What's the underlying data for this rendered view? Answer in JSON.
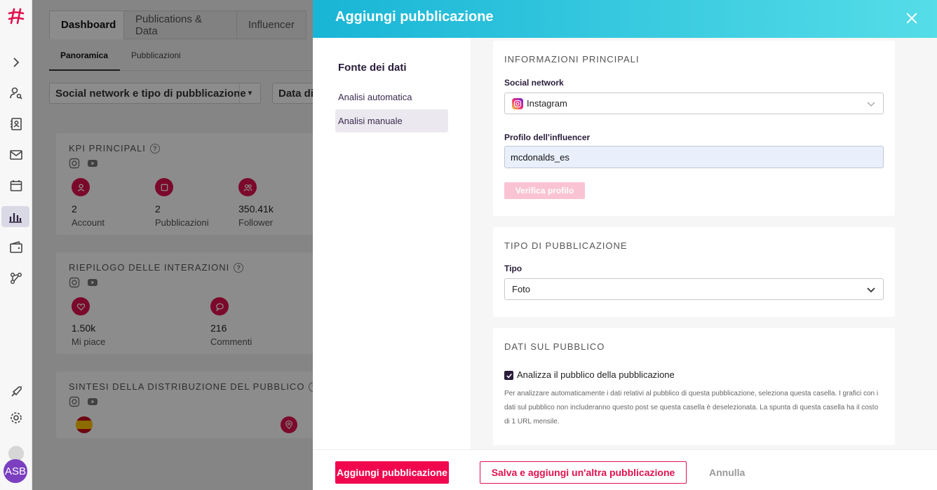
{
  "background": {
    "tabs": [
      "Dashboard",
      "Publications & Data",
      "Influencer"
    ],
    "subtabs": [
      "Panoramica",
      "Pubblicazioni"
    ],
    "filters": [
      "Social network e tipo di pubblicazione",
      "Data di"
    ],
    "kpi_card": {
      "title": "KPI PRINCIPALI",
      "items": [
        {
          "value": "2",
          "label": "Account"
        },
        {
          "value": "2",
          "label": "Pubblicazioni"
        },
        {
          "value": "350.41k",
          "label": "Follower"
        }
      ]
    },
    "interactions_card": {
      "title": "RIEPILOGO DELLE INTERAZIONI",
      "items": [
        {
          "value": "1.50k",
          "label": "Mi piace"
        },
        {
          "value": "216",
          "label": "Commenti"
        }
      ]
    },
    "audience_card": {
      "title": "SINTESI DELLA DISTRIBUZIONE DEL PUBBLICO"
    },
    "avatar_initials": "ASB"
  },
  "modal": {
    "title": "Aggiungi pubblicazione",
    "sidebar": {
      "heading": "Fonte dei dati",
      "items": [
        "Analisi automatica",
        "Analisi manuale"
      ],
      "active": "Analisi manuale"
    },
    "main_info": {
      "title": "INFORMAZIONI PRINCIPALI",
      "social_label": "Social network",
      "social_value": "Instagram",
      "profile_label": "Profilo dell'influencer",
      "profile_value": "mcdonalds_es",
      "verify_label": "Verifica profilo"
    },
    "pub_type": {
      "title": "TIPO DI PUBBLICAZIONE",
      "type_label": "Tipo",
      "type_value": "Foto"
    },
    "audience": {
      "title": "DATI SUL PUBBLICO",
      "checkbox_label": "Analizza il pubblico della pubblicazione",
      "help_text": "Per analizzare automaticamente i dati relativi al pubblico di questa pubblicazione, seleziona questa casella. I grafici con i dati sul pubblico non includeranno questo post se questa casella è deselezionata. La spunta di questa casella ha il costo di 1 URL mensile."
    },
    "footer": {
      "primary": "Aggiungi pubblicazione",
      "secondary": "Salva e aggiungi un'altra pubblicazione",
      "cancel": "Annulla"
    }
  },
  "colors": {
    "accent": "#e0114f",
    "header_start": "#19b5d6",
    "header_end": "#55dde8"
  }
}
